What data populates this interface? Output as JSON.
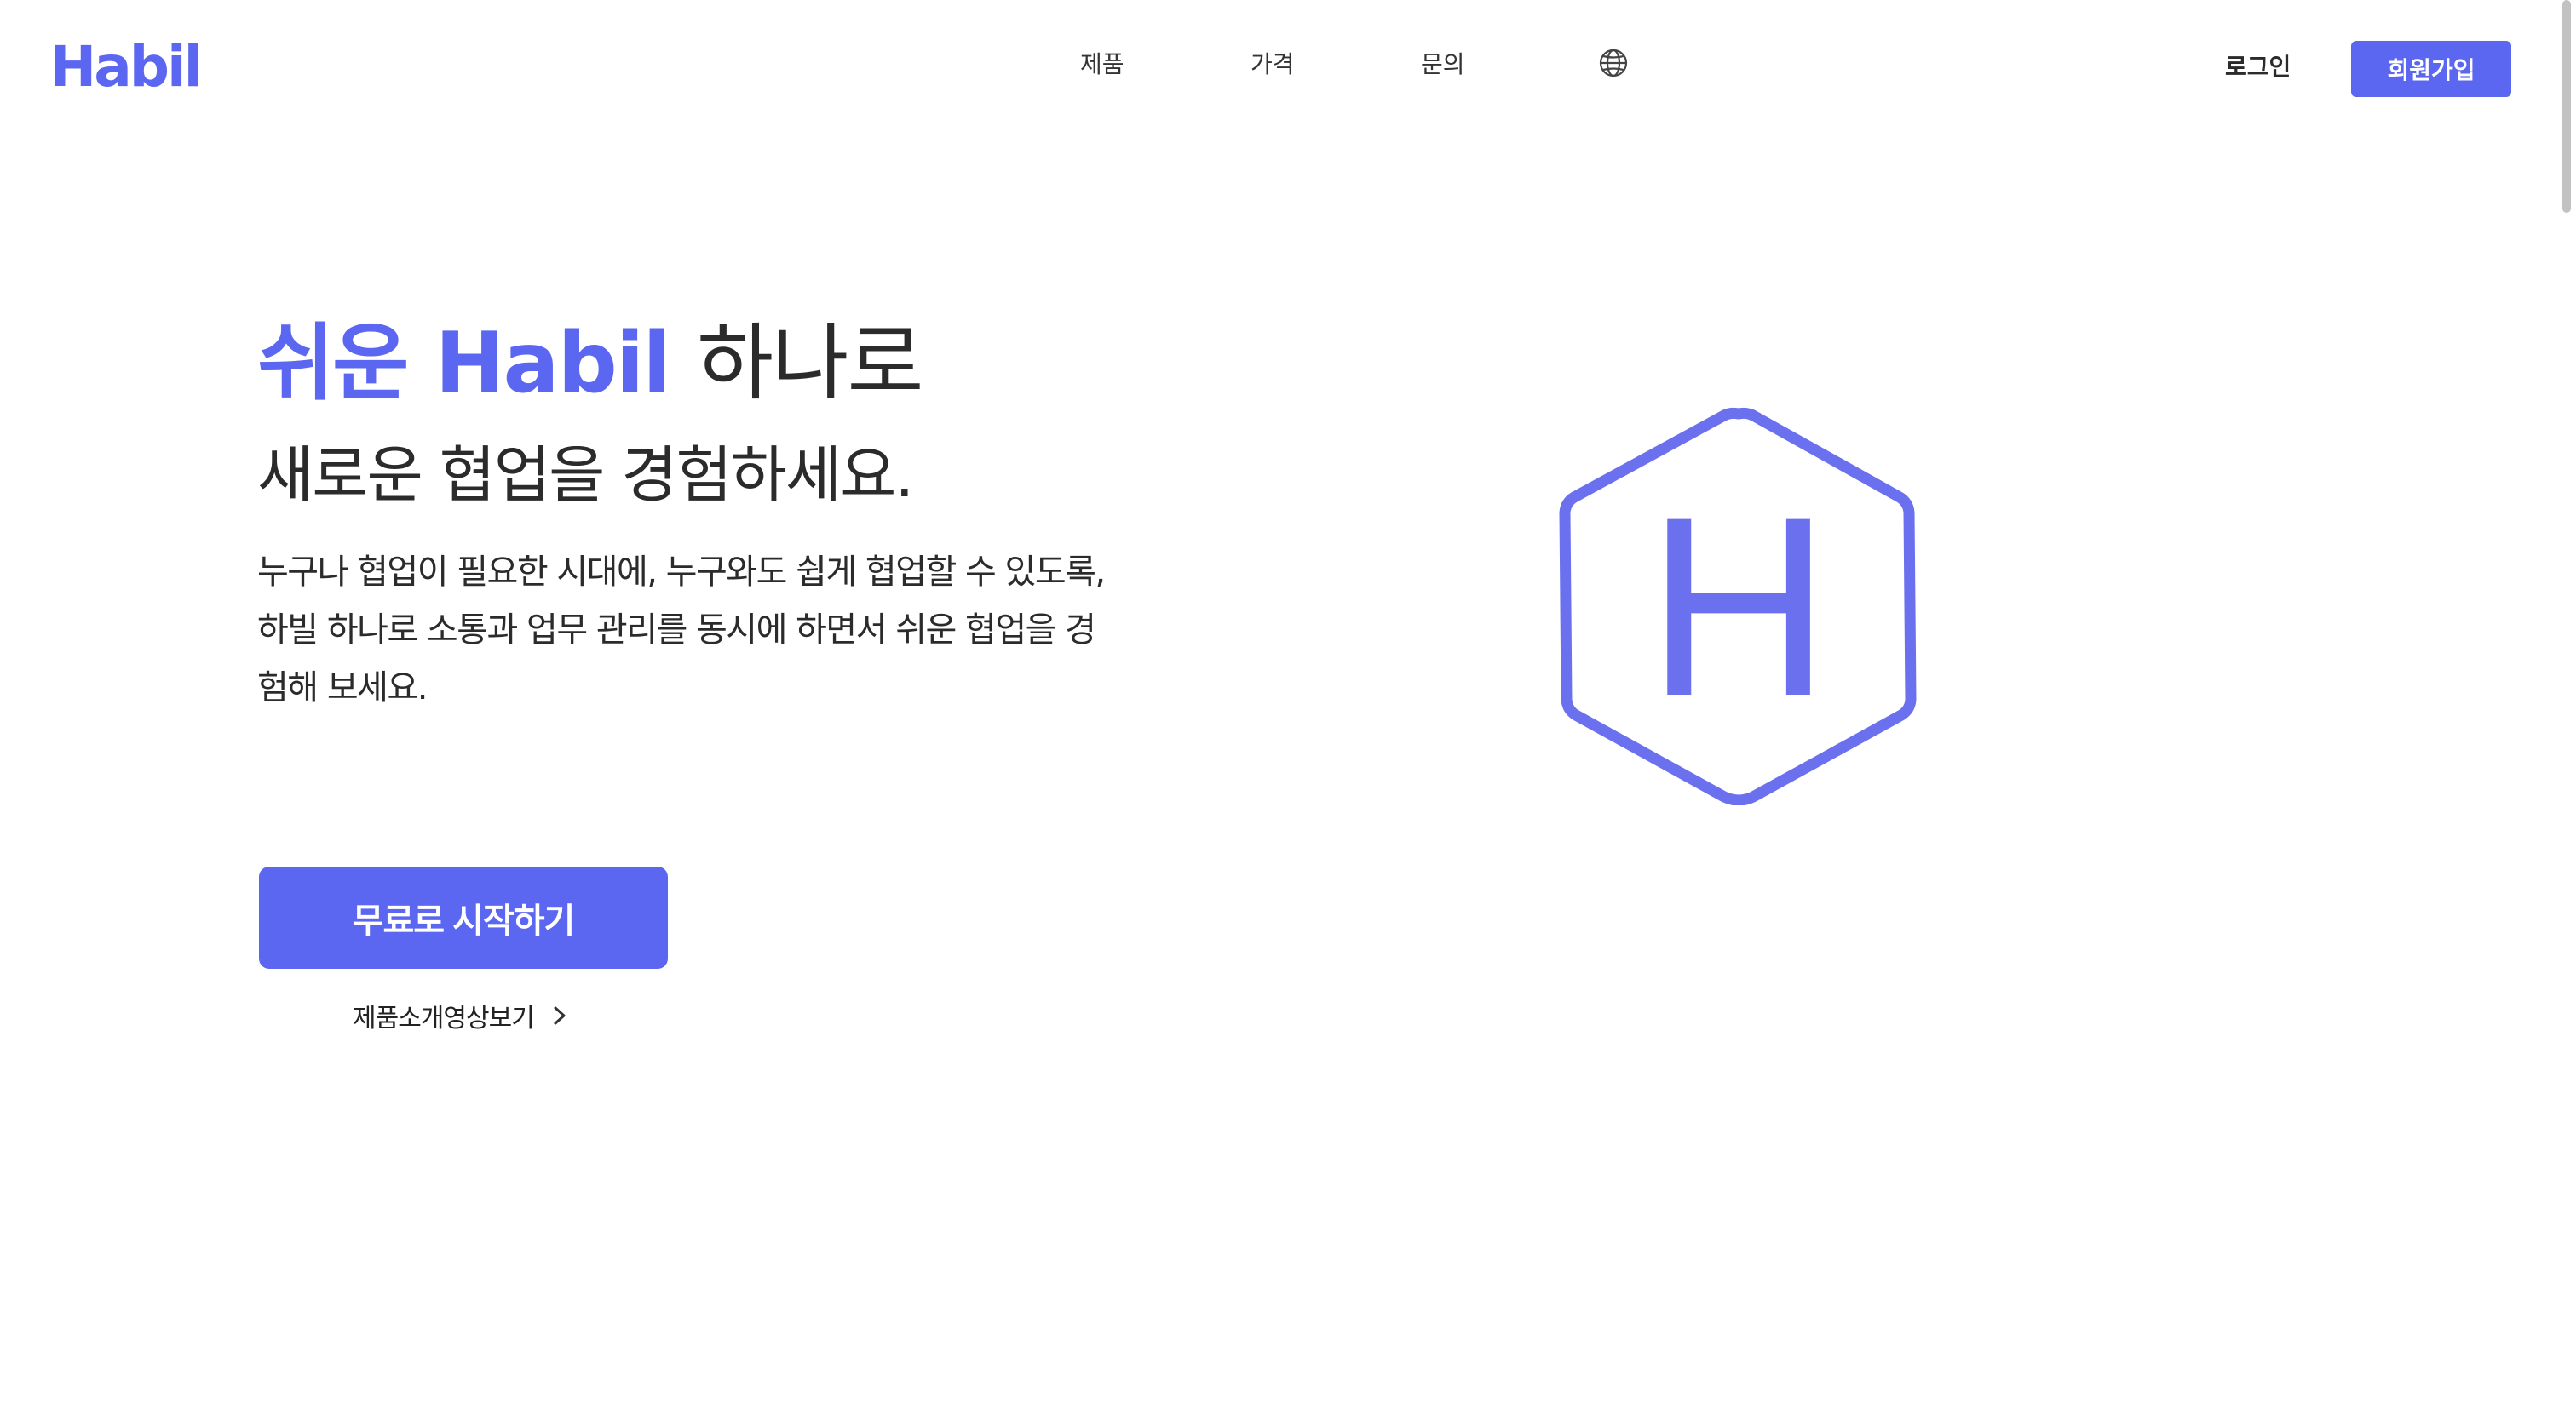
{
  "header": {
    "logo_text": "Habil",
    "nav": {
      "products": "제품",
      "pricing": "가격",
      "contact": "문의"
    },
    "language_icon": "globe-icon",
    "login_label": "로그인",
    "signup_label": "회원가입"
  },
  "hero": {
    "headline_accent": "쉬운 Habil",
    "headline_rest": "하나로",
    "subheadline": "새로운 협업을 경험하세요.",
    "description_lines": [
      "누구나 협업이 필요한 시대에, 누구와도 쉽게 협업할 수 있도록,",
      "하빌 하나로 소통과 업무 관리를 동시에 하면서 쉬운 협업을 경",
      "험해 보세요."
    ],
    "cta_label": "무료로 시작하기",
    "video_link_label": "제품소개영상보기",
    "video_link_icon": "chevron-right-icon",
    "illustration": {
      "icon": "hexagon-h-logo-icon",
      "letter": "H"
    }
  },
  "colors": {
    "brand": "#5b67f1",
    "text": "#2b2b2b",
    "background": "#ffffff"
  }
}
